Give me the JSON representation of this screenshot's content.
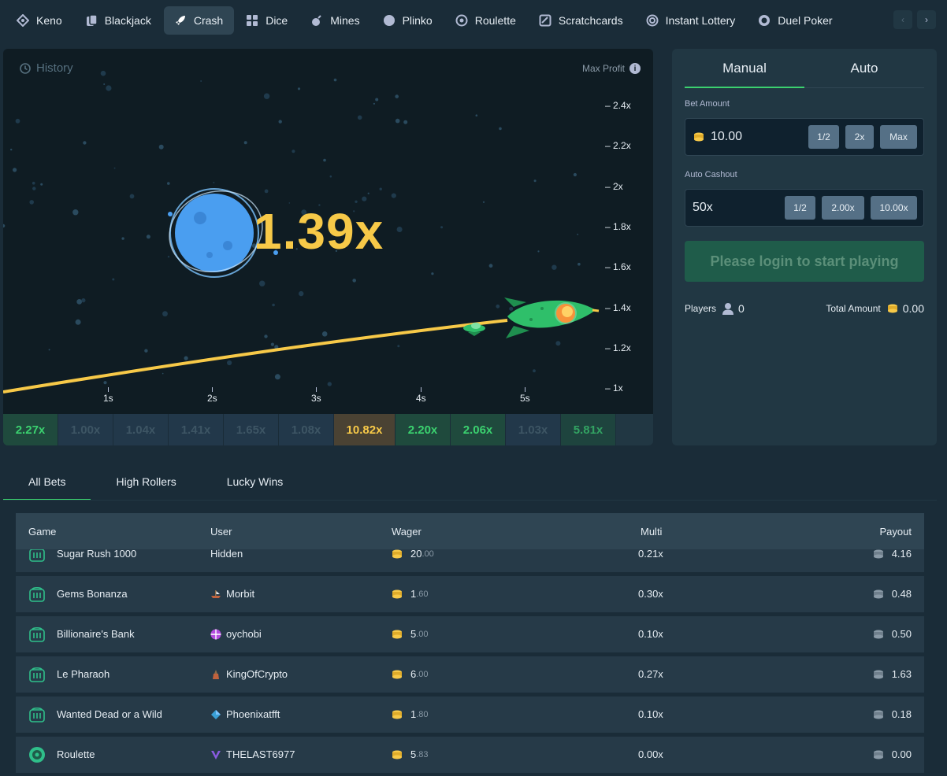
{
  "nav": {
    "items": [
      {
        "label": "Keno",
        "icon": "keno-icon"
      },
      {
        "label": "Blackjack",
        "icon": "blackjack-icon"
      },
      {
        "label": "Crash",
        "icon": "rocket-icon",
        "active": true
      },
      {
        "label": "Dice",
        "icon": "dice-icon"
      },
      {
        "label": "Mines",
        "icon": "bomb-icon"
      },
      {
        "label": "Plinko",
        "icon": "plinko-icon"
      },
      {
        "label": "Roulette",
        "icon": "roulette-icon"
      },
      {
        "label": "Scratchcards",
        "icon": "scratchcard-icon"
      },
      {
        "label": "Instant Lottery",
        "icon": "lottery-icon"
      },
      {
        "label": "Duel Poker",
        "icon": "poker-chip-icon"
      }
    ],
    "prev_arrow": "‹",
    "next_arrow": "›"
  },
  "game": {
    "history_label": "History",
    "max_profit_label": "Max Profit",
    "info_glyph": "i",
    "multiplier": "1.39x",
    "y_ticks": [
      "– 2.4x",
      "– 2.2x",
      "– 2x",
      "– 1.8x",
      "– 1.6x",
      "– 1.4x",
      "– 1.2x",
      "– 1x"
    ],
    "x_ticks": [
      "1s",
      "2s",
      "3s",
      "4s",
      "5s"
    ]
  },
  "history_strip": [
    {
      "value": "2.27x",
      "kind": "green"
    },
    {
      "value": "1.00x",
      "kind": "grey"
    },
    {
      "value": "1.04x",
      "kind": "grey"
    },
    {
      "value": "1.41x",
      "kind": "grey"
    },
    {
      "value": "1.65x",
      "kind": "grey"
    },
    {
      "value": "1.08x",
      "kind": "grey"
    },
    {
      "value": "10.82x",
      "kind": "gold"
    },
    {
      "value": "2.20x",
      "kind": "green"
    },
    {
      "value": "2.06x",
      "kind": "green"
    },
    {
      "value": "1.03x",
      "kind": "grey"
    },
    {
      "value": "5.81x",
      "kind": "green"
    }
  ],
  "bet_panel": {
    "tabs": [
      "Manual",
      "Auto"
    ],
    "bet_amount_label": "Bet Amount",
    "bet_amount_value": "10.00",
    "bet_buttons": [
      "1/2",
      "2x",
      "Max"
    ],
    "auto_cashout_label": "Auto Cashout",
    "auto_cashout_value": "50x",
    "cashout_buttons": [
      "1/2",
      "2.00x",
      "10.00x"
    ],
    "login_button": "Please login to start playing",
    "players_label": "Players",
    "players_value": "0",
    "total_label": "Total Amount",
    "total_value": "0.00"
  },
  "bets": {
    "tabs": [
      "All Bets",
      "High Rollers",
      "Lucky Wins"
    ],
    "headers": {
      "game": "Game",
      "user": "User",
      "wager": "Wager",
      "multi": "Multi",
      "payout": "Payout"
    },
    "rows": [
      {
        "game": "Sugar Rush 1000",
        "user": "Hidden",
        "user_icon": "",
        "wager_int": "20",
        "wager_dec": ".00",
        "multi": "0.21x",
        "payout": "4.16"
      },
      {
        "game": "Gems Bonanza",
        "user": "Morbit",
        "user_icon": "ship-icon",
        "wager_int": "1",
        "wager_dec": ".60",
        "multi": "0.30x",
        "payout": "0.48"
      },
      {
        "game": "Billionaire's Bank",
        "user": "oychobi",
        "user_icon": "pinwheel-icon",
        "wager_int": "5",
        "wager_dec": ".00",
        "multi": "0.10x",
        "payout": "0.50"
      },
      {
        "game": "Le Pharaoh",
        "user": "KingOfCrypto",
        "user_icon": "tower-icon",
        "wager_int": "6",
        "wager_dec": ".00",
        "multi": "0.27x",
        "payout": "1.63"
      },
      {
        "game": "Wanted Dead or a Wild",
        "user": "Phoenixatfft",
        "user_icon": "diamond-icon",
        "wager_int": "1",
        "wager_dec": ".80",
        "multi": "0.10x",
        "payout": "0.18"
      },
      {
        "game": "Roulette",
        "user": "THELAST6977",
        "user_icon": "crest-icon",
        "wager_int": "5",
        "wager_dec": ".83",
        "multi": "0.00x",
        "payout": "0.00"
      }
    ]
  }
}
